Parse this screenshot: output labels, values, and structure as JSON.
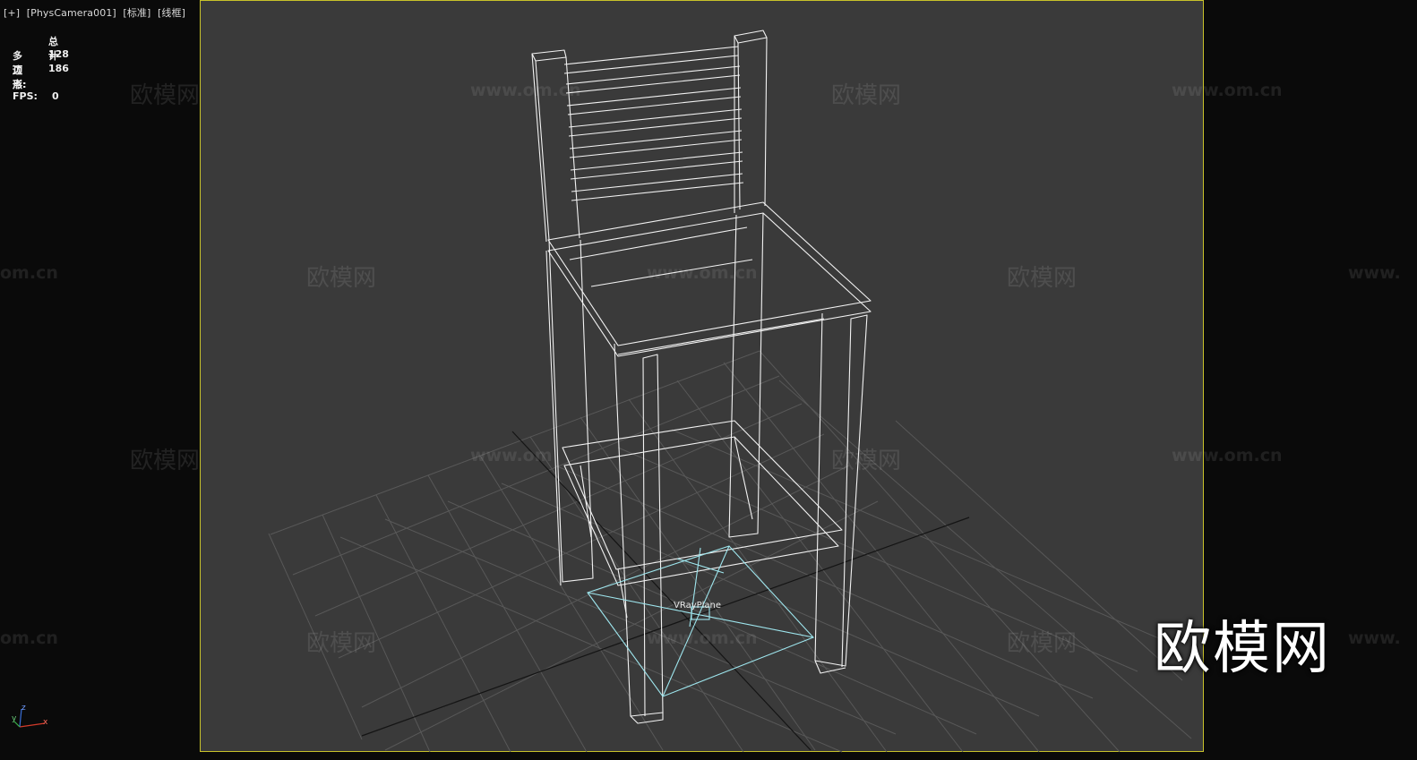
{
  "viewport": {
    "menu_plus": "[+]",
    "camera": "[PhysCamera001]",
    "shading_mode": "[标准]",
    "display_mode": "[线框]"
  },
  "stats": {
    "header": "总计",
    "polygons_label": "多边形:",
    "polygons_value": "128",
    "vertices_label": "顶点:",
    "vertices_value": "186",
    "fps_label": "FPS:",
    "fps_value": "0"
  },
  "scene": {
    "object_label": "VRayPlane",
    "axis_z": "z",
    "axis_x": "x",
    "axis_y": "y"
  },
  "watermarks": {
    "brand": "欧模网",
    "url": "www.om.cn",
    "url_cut": "om.cn",
    "url_cut_left": "www.",
    "url_partial": "www.om"
  },
  "logo": "欧模网",
  "colors": {
    "frame_border": "#c8c22a",
    "viewport_bg": "#3a3a3a",
    "wireframe": "#ffffff",
    "vray_plane": "#9ee6ee",
    "grid": "#585858"
  }
}
